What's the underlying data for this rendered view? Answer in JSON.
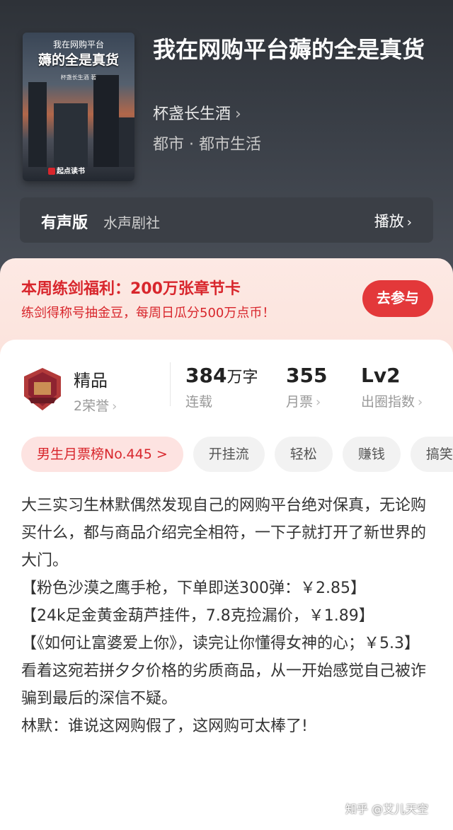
{
  "book": {
    "cover": {
      "top_text": "我在网购平台",
      "title_text": "薅的全是真货",
      "author_text": "杯盏长生酒 著",
      "publisher_text": "起点读书"
    },
    "title": "我在网购平台薅的全是真货",
    "author": "杯盏长生酒",
    "genre": "都市 · 都市生活",
    "audio": {
      "label": "有声版",
      "studio": "水声剧社",
      "play": "播放"
    }
  },
  "promo": {
    "title": "本周练剑福利：200万张章节卡",
    "subtitle": "练剑得称号抽金豆，每周日瓜分500万点币！",
    "button": "去参与"
  },
  "stats": {
    "quality": {
      "value": "精品",
      "sub": "2荣誉"
    },
    "words": {
      "value": "384",
      "unit": "万字",
      "sub": "连载"
    },
    "tickets": {
      "value": "355",
      "sub": "月票"
    },
    "level": {
      "value": "Lv2",
      "sub": "出圈指数"
    }
  },
  "tags": [
    "男生月票榜No.445 >",
    "开挂流",
    "轻松",
    "赚钱",
    "搞笑"
  ],
  "description": [
    "大三实习生林默偶然发现自己的网购平台绝对保真，无论购买什么，都与商品介绍完全相符，一下子就打开了新世界的大门。",
    "【粉色沙漠之鹰手枪，下单即送300弹：￥2.85】",
    "【24k足金黄金葫芦挂件，7.8克捡漏价，￥1.89】",
    "【《如何让富婆爱上你》，读完让你懂得女神的心；￥5.3】",
    "看着这宛若拼夕夕价格的劣质商品，从一开始感觉自己被诈骗到最后的深信不疑。",
    "林默：谁说这网购假了，这网购可太棒了!"
  ],
  "watermark": "知乎 @艾儿天空",
  "colors": {
    "accent": "#d8262c",
    "header_bg": "#33373e"
  },
  "icons": {
    "chevron": "chevron-right-icon",
    "badge": "quality-badge-icon"
  }
}
